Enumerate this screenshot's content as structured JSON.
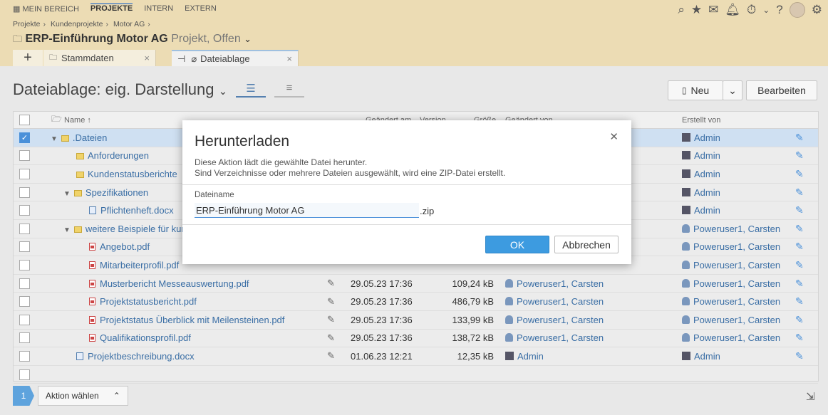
{
  "nav": {
    "items": [
      "MEIN BEREICH",
      "PROJEKTE",
      "INTERN",
      "EXTERN"
    ],
    "active": "PROJEKTE"
  },
  "header": {
    "breadcrumb": [
      "Projekte",
      "Kundenprojekte",
      "Motor AG"
    ],
    "title": "ERP-Einführung Motor AG",
    "subtitle": "Projekt, Offen"
  },
  "tabs": [
    {
      "label": "Stammdaten",
      "close": "×"
    },
    {
      "label": "Dateiablage",
      "close": "×"
    }
  ],
  "toolbar": {
    "heading": "Dateiablage: eig. Darstellung",
    "new_label": "Neu",
    "edit_label": "Bearbeiten"
  },
  "table": {
    "columns": [
      "Name",
      "Geändert am",
      "Version",
      "Größe",
      "Geändert von",
      "Erstellt von"
    ],
    "rows": [
      {
        "name": ".Dateien",
        "type": "folder",
        "level": 1,
        "expanded": true,
        "modified": "",
        "size": "",
        "changed_by": "",
        "created_by": "Admin",
        "created_type": "admin",
        "selected": true
      },
      {
        "name": "Anforderungen",
        "type": "folder",
        "level": 2,
        "modified": "",
        "size": "",
        "changed_by": "",
        "created_by": "Admin",
        "created_type": "admin"
      },
      {
        "name": "Kundenstatusberichte",
        "type": "folder",
        "level": 2,
        "modified": "",
        "size": "",
        "changed_by": "",
        "created_by": "Admin",
        "created_type": "admin"
      },
      {
        "name": "Spezifikationen",
        "type": "folder",
        "level": 2,
        "expanded": true,
        "modified": "",
        "size": "",
        "changed_by": "",
        "created_by": "Admin",
        "created_type": "admin"
      },
      {
        "name": "Pflichtenheft.docx",
        "type": "doc",
        "level": 3,
        "modified": "",
        "size": "",
        "changed_by": "",
        "created_by": "Admin",
        "created_type": "admin"
      },
      {
        "name": "weitere Beispiele für kun",
        "type": "folder",
        "level": 2,
        "expanded": true,
        "modified": "",
        "size": "",
        "changed_by": "",
        "created_by": "Poweruser1, Carsten",
        "created_type": "user"
      },
      {
        "name": "Angebot.pdf",
        "type": "pdf",
        "level": 3,
        "modified": "",
        "size": "",
        "changed_by": "",
        "created_by": "Poweruser1, Carsten",
        "created_type": "user"
      },
      {
        "name": "Mitarbeiterprofil.pdf",
        "type": "pdf",
        "level": 3,
        "modified": "",
        "size": "",
        "changed_by": "",
        "created_by": "Poweruser1, Carsten",
        "created_type": "user"
      },
      {
        "name": "Musterbericht Messeauswertung.pdf",
        "type": "pdf",
        "level": 3,
        "modified": "29.05.23 17:36",
        "size": "109,24 kB",
        "changed_by": "Poweruser1, Carsten",
        "created_by": "Poweruser1, Carsten",
        "created_type": "user"
      },
      {
        "name": "Projektstatusbericht.pdf",
        "type": "pdf",
        "level": 3,
        "modified": "29.05.23 17:36",
        "size": "486,79 kB",
        "changed_by": "Poweruser1, Carsten",
        "created_by": "Poweruser1, Carsten",
        "created_type": "user"
      },
      {
        "name": "Projektstatus Überblick mit Meilensteinen.pdf",
        "type": "pdf",
        "level": 3,
        "modified": "29.05.23 17:36",
        "size": "133,99 kB",
        "changed_by": "Poweruser1, Carsten",
        "created_by": "Poweruser1, Carsten",
        "created_type": "user"
      },
      {
        "name": "Qualifikationsprofil.pdf",
        "type": "pdf",
        "level": 3,
        "modified": "29.05.23 17:36",
        "size": "138,72 kB",
        "changed_by": "Poweruser1, Carsten",
        "created_by": "Poweruser1, Carsten",
        "created_type": "user"
      },
      {
        "name": "Projektbeschreibung.docx",
        "type": "doc",
        "level": 2,
        "modified": "01.06.23 12:21",
        "size": "12,35 kB",
        "changed_by": "Admin",
        "changed_type": "admin",
        "created_by": "Admin",
        "created_type": "admin"
      }
    ]
  },
  "footer": {
    "selected_count": "1",
    "action_label": "Aktion wählen"
  },
  "dialog": {
    "title": "Herunterladen",
    "line1": "Diese Aktion lädt die gewählte Datei herunter.",
    "line2": "Sind Verzeichnisse oder mehrere Dateien ausgewählt, wird eine ZIP-Datei erstellt.",
    "field_label": "Dateiname",
    "field_value": "ERP-Einführung Motor AG",
    "extension": ".zip",
    "ok_label": "OK",
    "cancel_label": "Abbrechen"
  },
  "colors": {
    "accent": "#3d9be0",
    "header_bg": "#ecdcb4",
    "link": "#3a6ea5"
  }
}
